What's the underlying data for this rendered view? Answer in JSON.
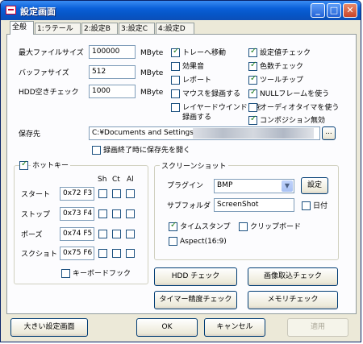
{
  "window": {
    "title": "設定画面",
    "minimize": "_",
    "maximize": "□",
    "close": "✕"
  },
  "tabs": [
    {
      "label": "全般",
      "selected": true
    },
    {
      "label": "1:ラテール",
      "selected": false
    },
    {
      "label": "2:設定B",
      "selected": false
    },
    {
      "label": "3:設定C",
      "selected": false
    },
    {
      "label": "4:設定D",
      "selected": false
    }
  ],
  "general": {
    "max_file_size": {
      "label": "最大ファイルサイズ",
      "value": "100000",
      "unit": "MByte"
    },
    "buffer_size": {
      "label": "バッファサイズ",
      "value": "512",
      "unit": "MByte"
    },
    "hdd_free_check": {
      "label": "HDD空きチェック",
      "value": "1000",
      "unit": "MByte"
    }
  },
  "options_left": [
    {
      "label": "トレーへ移動",
      "checked": true
    },
    {
      "label": "効果音",
      "checked": false
    },
    {
      "label": "レポート",
      "checked": false
    },
    {
      "label": "マウスを録画する",
      "checked": false
    },
    {
      "label": "レイヤードウインドウを",
      "label2": "録画する",
      "checked": false
    }
  ],
  "options_right": [
    {
      "label": "設定値チェック",
      "checked": true
    },
    {
      "label": "色数チェック",
      "checked": true
    },
    {
      "label": "ツールチップ",
      "checked": true
    },
    {
      "label": "NULLフレームを使う",
      "checked": true
    },
    {
      "label": "オーディオタイマを使う",
      "checked": false
    },
    {
      "label": "コンポジション無効",
      "checked": true
    }
  ],
  "save": {
    "label": "保存先",
    "path": "C:¥Documents and Settings",
    "browse": "...",
    "open_after_label": "録画終了時に保存先を開く",
    "open_after_checked": false
  },
  "hotkey": {
    "enabled_label": "ホットキー",
    "enabled": true,
    "columns": [
      "Sh",
      "Ct",
      "Al"
    ],
    "rows": [
      {
        "label": "スタート",
        "key": "0x72 F3"
      },
      {
        "label": "ストップ",
        "key": "0x73 F4"
      },
      {
        "label": "ポーズ",
        "key": "0x74 F5"
      },
      {
        "label": "スクショト",
        "key": "0x75 F6"
      }
    ],
    "keyboard_hook_label": "キーボードフック",
    "keyboard_hook": false
  },
  "screenshot": {
    "title": "スクリーンショット",
    "plugin_label": "プラグイン",
    "plugin_value": "BMP",
    "settings_button": "設定",
    "subfolder_label": "サブフォルダ",
    "subfolder_value": "ScreenShot",
    "date_label": "日付",
    "date_checked": false,
    "timestamp_label": "タイムスタンプ",
    "timestamp_checked": true,
    "clipboard_label": "クリップボード",
    "clipboard_checked": false,
    "aspect_label": "Aspect(16:9)",
    "aspect_checked": false
  },
  "buttons": {
    "hdd_check": "HDD チェック",
    "image_capture_check": "画像取込チェック",
    "timer_precision_check": "タイマー精度チェック",
    "memory_check": "メモリチェック"
  },
  "footer": {
    "large_settings": "大きい設定画面",
    "ok": "OK",
    "cancel": "キャンセル",
    "apply": "適用"
  }
}
